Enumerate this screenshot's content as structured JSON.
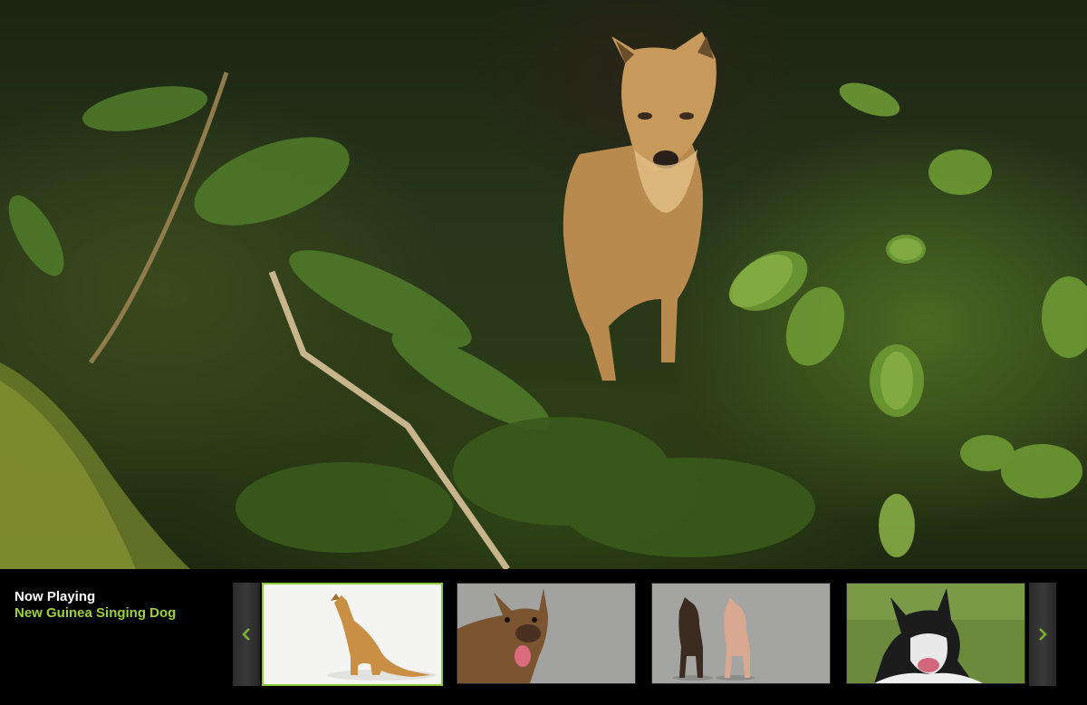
{
  "now_playing": {
    "label": "Now Playing",
    "title": "New Guinea Singing Dog"
  },
  "carousel": {
    "prev_icon": "chevron-left-icon",
    "next_icon": "chevron-right-icon",
    "thumbnails": [
      {
        "subject": "singing-dog-howling",
        "active": true
      },
      {
        "subject": "dog-panting-portrait",
        "active": false
      },
      {
        "subject": "two-dogs-standing",
        "active": false
      },
      {
        "subject": "black-white-dog-on-grass",
        "active": false
      }
    ]
  },
  "colors": {
    "accent": "#9fd13a",
    "active_border": "#8fc63a",
    "bar_background": "#000000"
  }
}
